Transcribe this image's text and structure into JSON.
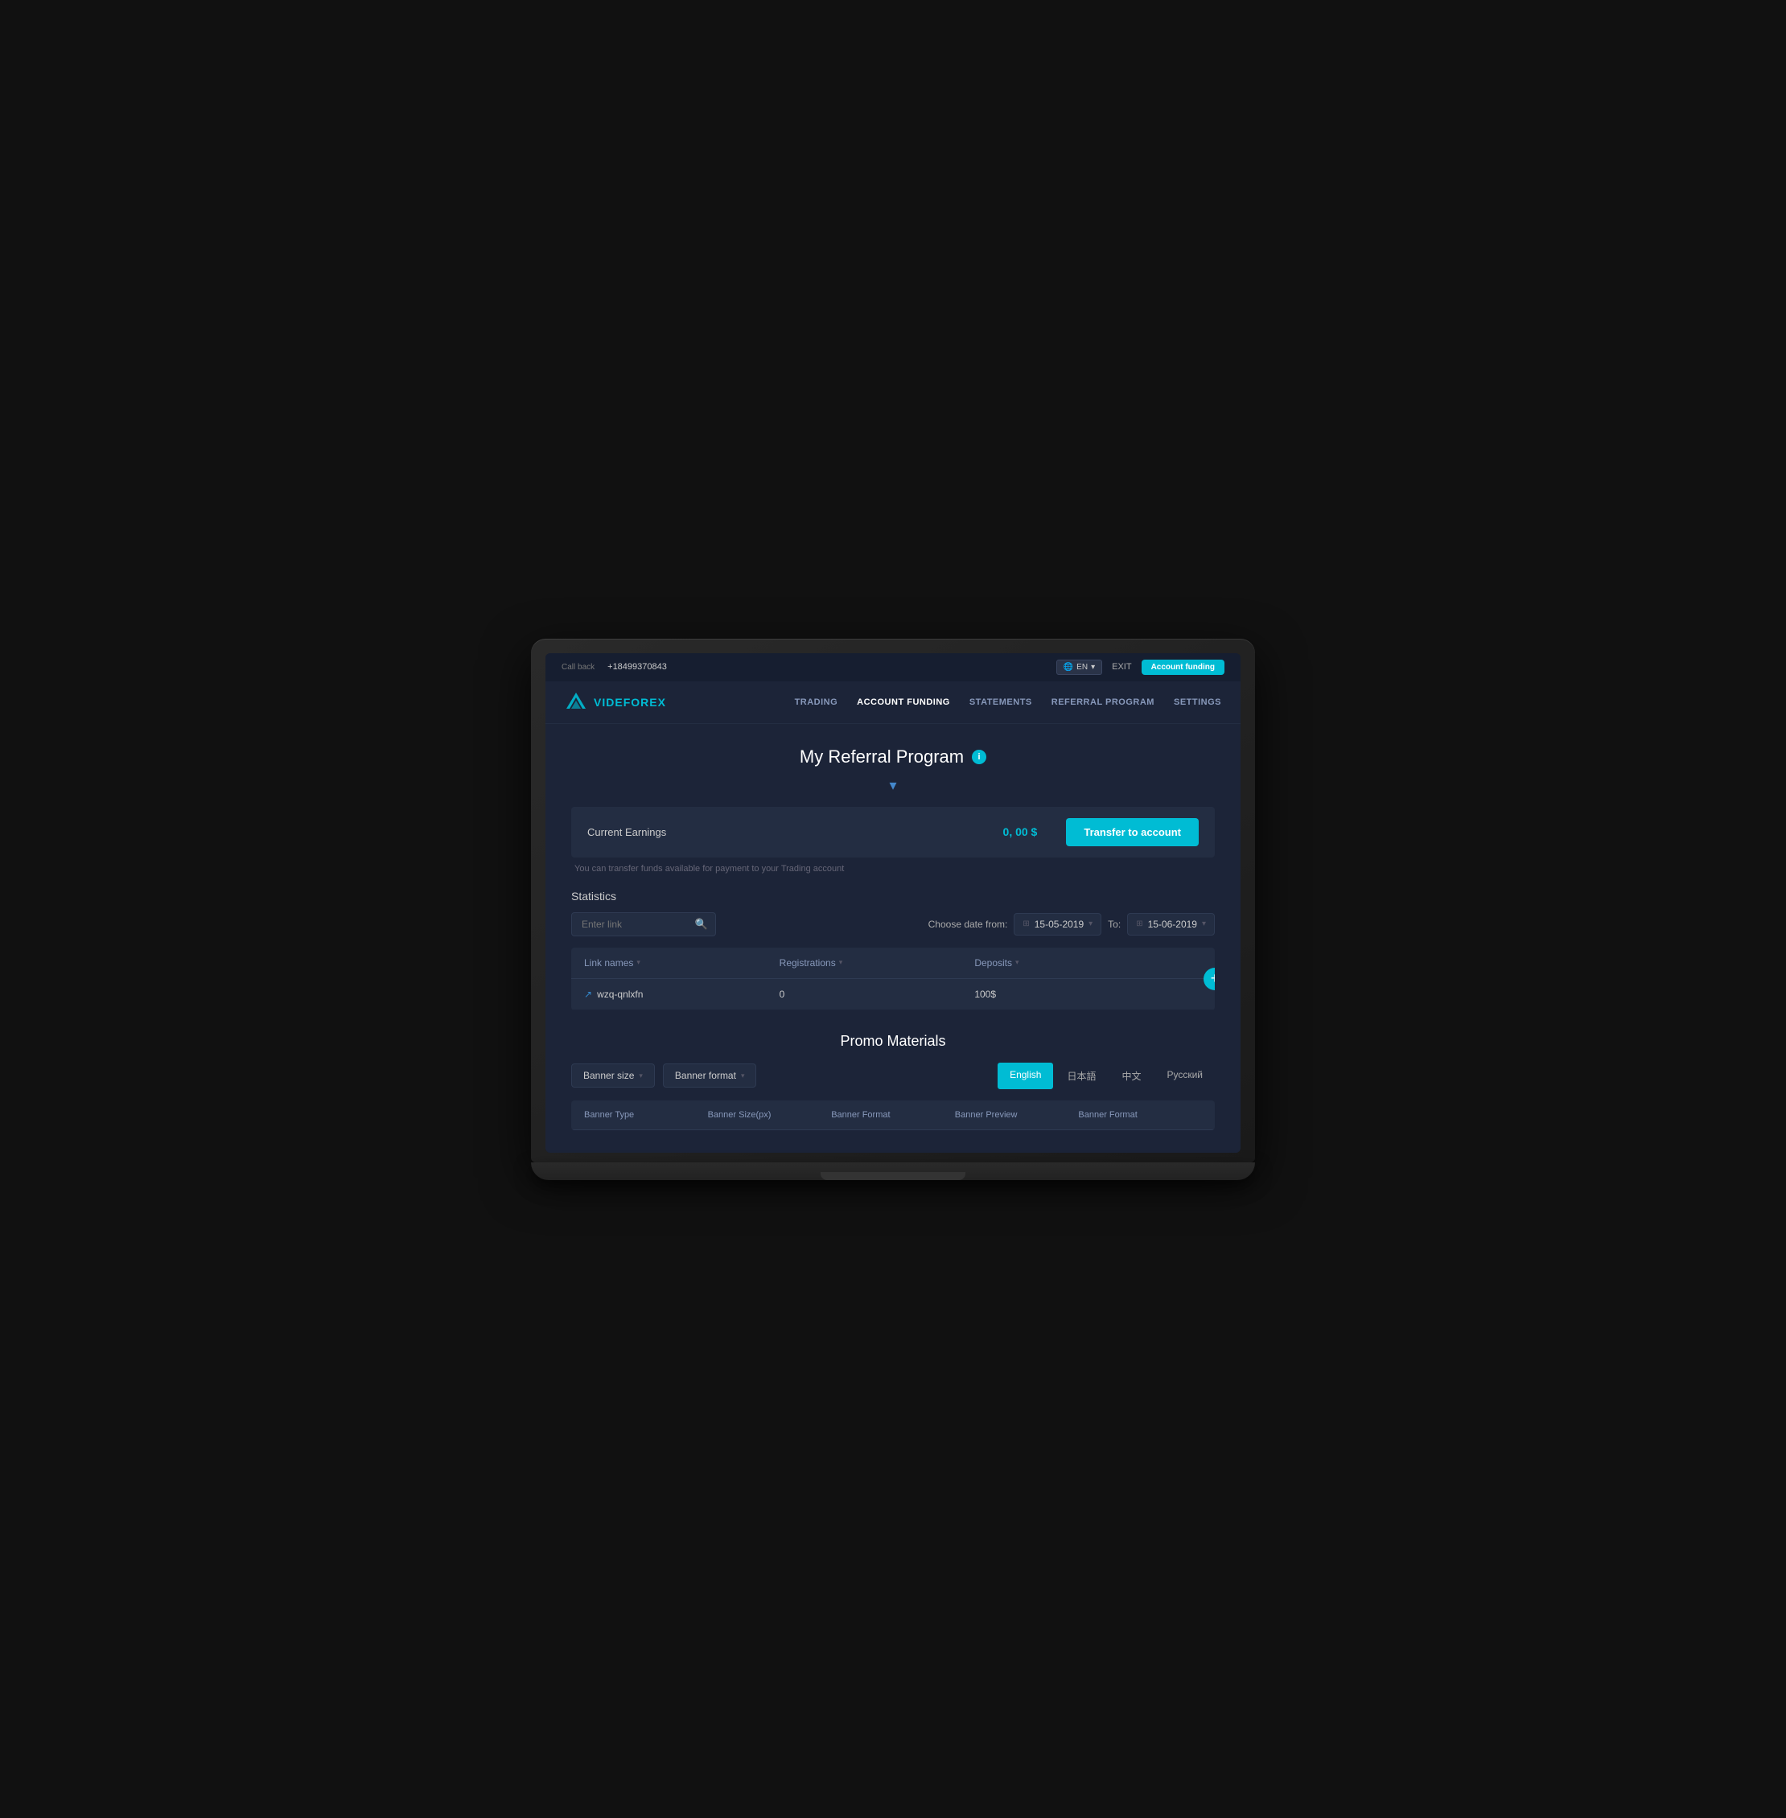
{
  "topbar": {
    "callback_label": "Call back",
    "phone": "+18499370843",
    "lang": "EN",
    "exit_label": "EXIT",
    "account_funding_label": "Account funding"
  },
  "nav": {
    "logo_text_part1": "VIDE",
    "logo_text_part2": "FOREX",
    "links": [
      {
        "id": "trading",
        "label": "TRADING",
        "active": false
      },
      {
        "id": "account-funding",
        "label": "ACCOUNT FUNDING",
        "active": true
      },
      {
        "id": "statements",
        "label": "STATEMENTS",
        "active": false
      },
      {
        "id": "referral-program",
        "label": "REFERRAL PROGRAM",
        "active": false
      },
      {
        "id": "settings",
        "label": "SETTINGS",
        "active": false
      }
    ]
  },
  "page": {
    "title": "My Referral Program",
    "info_icon": "i",
    "dropdown_arrow": "▾"
  },
  "earnings": {
    "label": "Current Earnings",
    "amount": "0, 00 $",
    "transfer_button": "Transfer to account",
    "note": "You can transfer funds available for payment to your Trading account"
  },
  "statistics": {
    "section_title": "Statistics",
    "search_placeholder": "Enter link",
    "date_from_label": "Choose date from:",
    "date_from": "15-05-2019",
    "date_to_label": "To:",
    "date_to": "15-06-2019",
    "table": {
      "columns": [
        {
          "label": "Link names",
          "sort": true
        },
        {
          "label": "Registrations",
          "sort": true
        },
        {
          "label": "Deposits",
          "sort": true
        }
      ],
      "rows": [
        {
          "link": "wzq-qnlxfn",
          "registrations": "0",
          "deposits": "100$"
        }
      ]
    },
    "add_btn": "+"
  },
  "promo": {
    "title": "Promo Materials",
    "dropdowns": [
      {
        "label": "Banner size",
        "id": "banner-size"
      },
      {
        "label": "Banner format",
        "id": "banner-format"
      }
    ],
    "lang_tabs": [
      {
        "label": "English",
        "active": true
      },
      {
        "label": "日本語",
        "active": false
      },
      {
        "label": "中文",
        "active": false
      },
      {
        "label": "Русский",
        "active": false
      }
    ],
    "table_columns": [
      "Banner Type",
      "Banner Size(px)",
      "Banner Format",
      "Banner Preview",
      "Banner Format"
    ]
  }
}
